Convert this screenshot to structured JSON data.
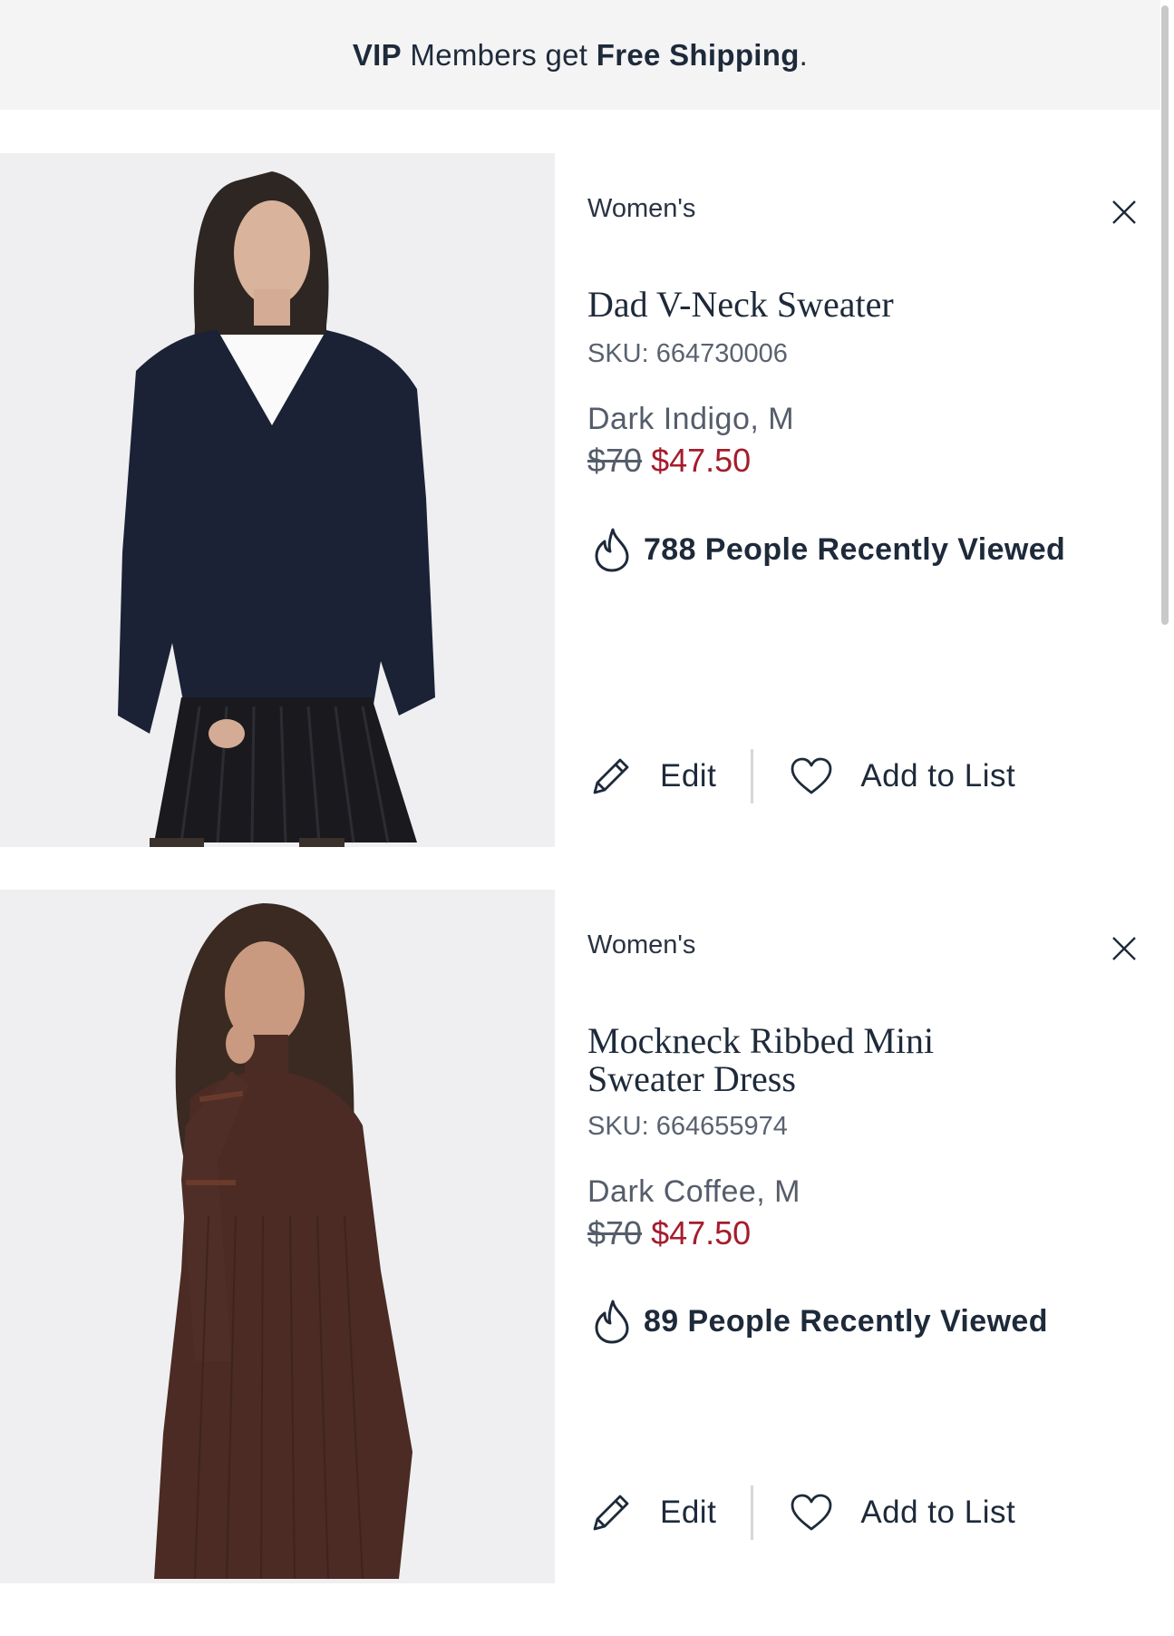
{
  "banner": {
    "vip": "VIP",
    "middle": " Members get ",
    "free_shipping": "Free Shipping",
    "end": "."
  },
  "items": [
    {
      "category": "Women's",
      "title": "Dad V-Neck Sweater",
      "sku": "SKU: 664730006",
      "variant": "Dark Indigo, M",
      "old_price": "$70",
      "new_price": "$47.50",
      "viewed": "788 People Recently Viewed",
      "edit_label": "Edit",
      "add_label": "Add to List"
    },
    {
      "category": "Women's",
      "title": "Mockneck Ribbed Mini Sweater Dress",
      "sku": "SKU: 664655974",
      "variant": "Dark Coffee, M",
      "old_price": "$70",
      "new_price": "$47.50",
      "viewed": "89 People Recently Viewed",
      "edit_label": "Edit",
      "add_label": "Add to List"
    }
  ],
  "colors": {
    "text": "#1e2a3a",
    "sale": "#a51c2c",
    "banner_bg": "#f4f4f5"
  },
  "icons": [
    "close-icon",
    "flame-icon",
    "pencil-icon",
    "heart-icon"
  ]
}
